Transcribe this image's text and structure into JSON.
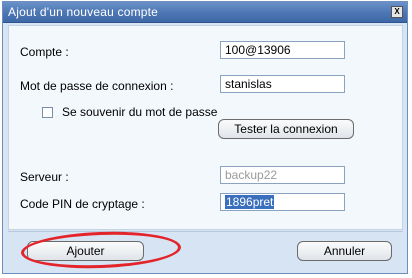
{
  "window": {
    "title": "Ajout d'un nouveau compte",
    "close_label": "X"
  },
  "form": {
    "account_label": "Compte :",
    "account_value": "100@13906",
    "password_label": "Mot de passe de connexion :",
    "password_value": "stanislas",
    "remember_label": "Se souvenir du mot de passe",
    "test_button": "Tester la connexion",
    "server_label": "Serveur :",
    "server_value": "backup22",
    "pin_label": "Code PIN de cryptage :",
    "pin_value": "1896pret"
  },
  "footer": {
    "add_button": "Ajouter",
    "cancel_button": "Annuler"
  },
  "colors": {
    "titlebar": "#4e78b5",
    "annotation": "#e4242b",
    "selection": "#3a6fbd"
  }
}
